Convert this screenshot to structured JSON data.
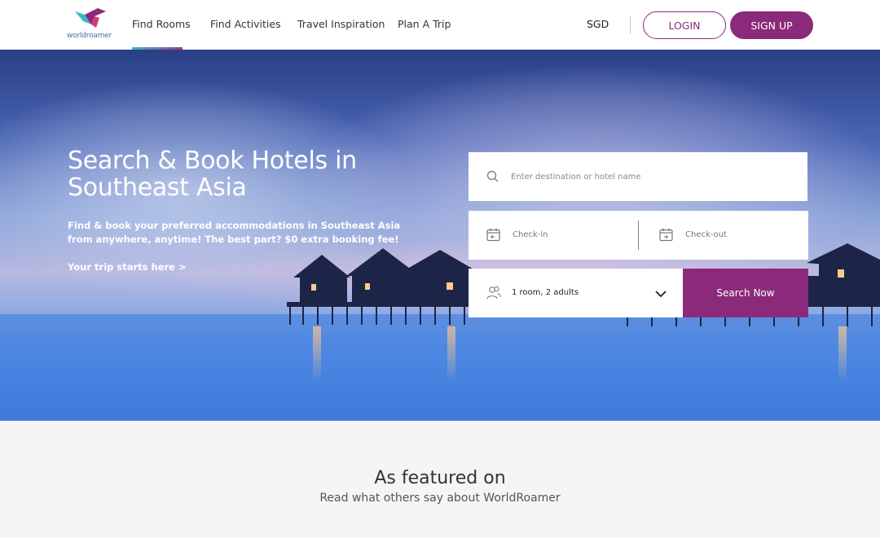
{
  "brand": {
    "logo_text": "worldroamer",
    "accent": "#8b2a7a",
    "teal": "#35b8c8"
  },
  "nav": {
    "items": [
      {
        "label": "Find Rooms",
        "active": true
      },
      {
        "label": "Find Activities",
        "active": false
      },
      {
        "label": "Travel Inspiration",
        "active": false
      },
      {
        "label": "Plan A Trip",
        "active": false
      }
    ],
    "currency": "SGD",
    "login_label": "LOGIN",
    "signup_label": "SIGN UP"
  },
  "hero": {
    "title": "Search & Book Hotels in Southeast Asia",
    "subtitle": "Find & book your preferred accommodations in Southeast Asia from anywhere, anytime! The best part? $0 extra booking fee!",
    "link": "Your trip starts here >"
  },
  "search": {
    "destination_placeholder": "Enter destination or hotel name",
    "checkin_label": "Check-in",
    "checkout_label": "Check-out",
    "guests_value": "1 room, 2 adults",
    "submit_label": "Search Now",
    "icons": {
      "destination": "search-icon",
      "dates": "calendar-icon",
      "guests": "people-icon",
      "dropdown": "chevron-down-icon"
    }
  },
  "featured": {
    "title": "As featured on",
    "subtitle": "Read what others say about WorldRoamer"
  }
}
